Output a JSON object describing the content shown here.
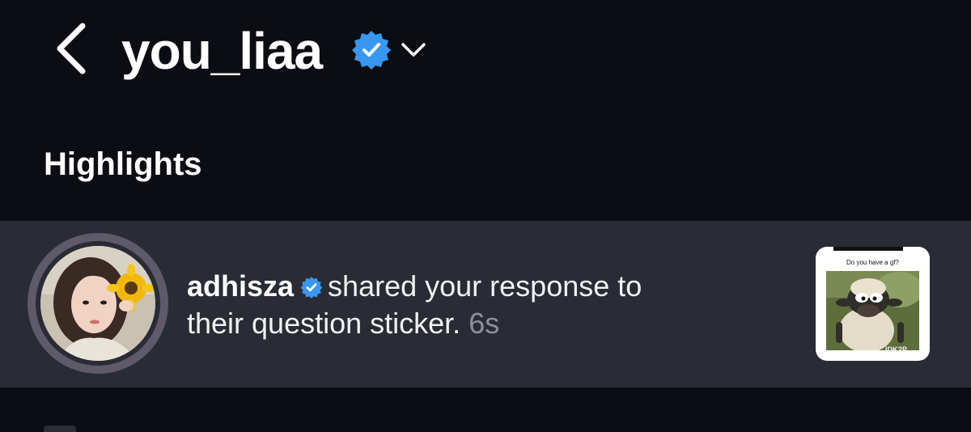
{
  "header": {
    "account_name": "you_liaa",
    "back_icon": "chevron-left-icon",
    "verified_icon": "verified-badge-icon",
    "dropdown_icon": "chevron-down-icon"
  },
  "section": {
    "title": "Highlights"
  },
  "notification": {
    "username": "adhisza",
    "message_line1": "shared your response to",
    "message_line2": "their question sticker.",
    "time": "6s",
    "thumbnail": {
      "question": "Do you have a gf?",
      "answer": "IDK?P"
    }
  },
  "colors": {
    "background": "#0b0d12",
    "row_background": "#292c35",
    "verified_blue": "#3897f0",
    "muted_text": "#8e9099"
  }
}
